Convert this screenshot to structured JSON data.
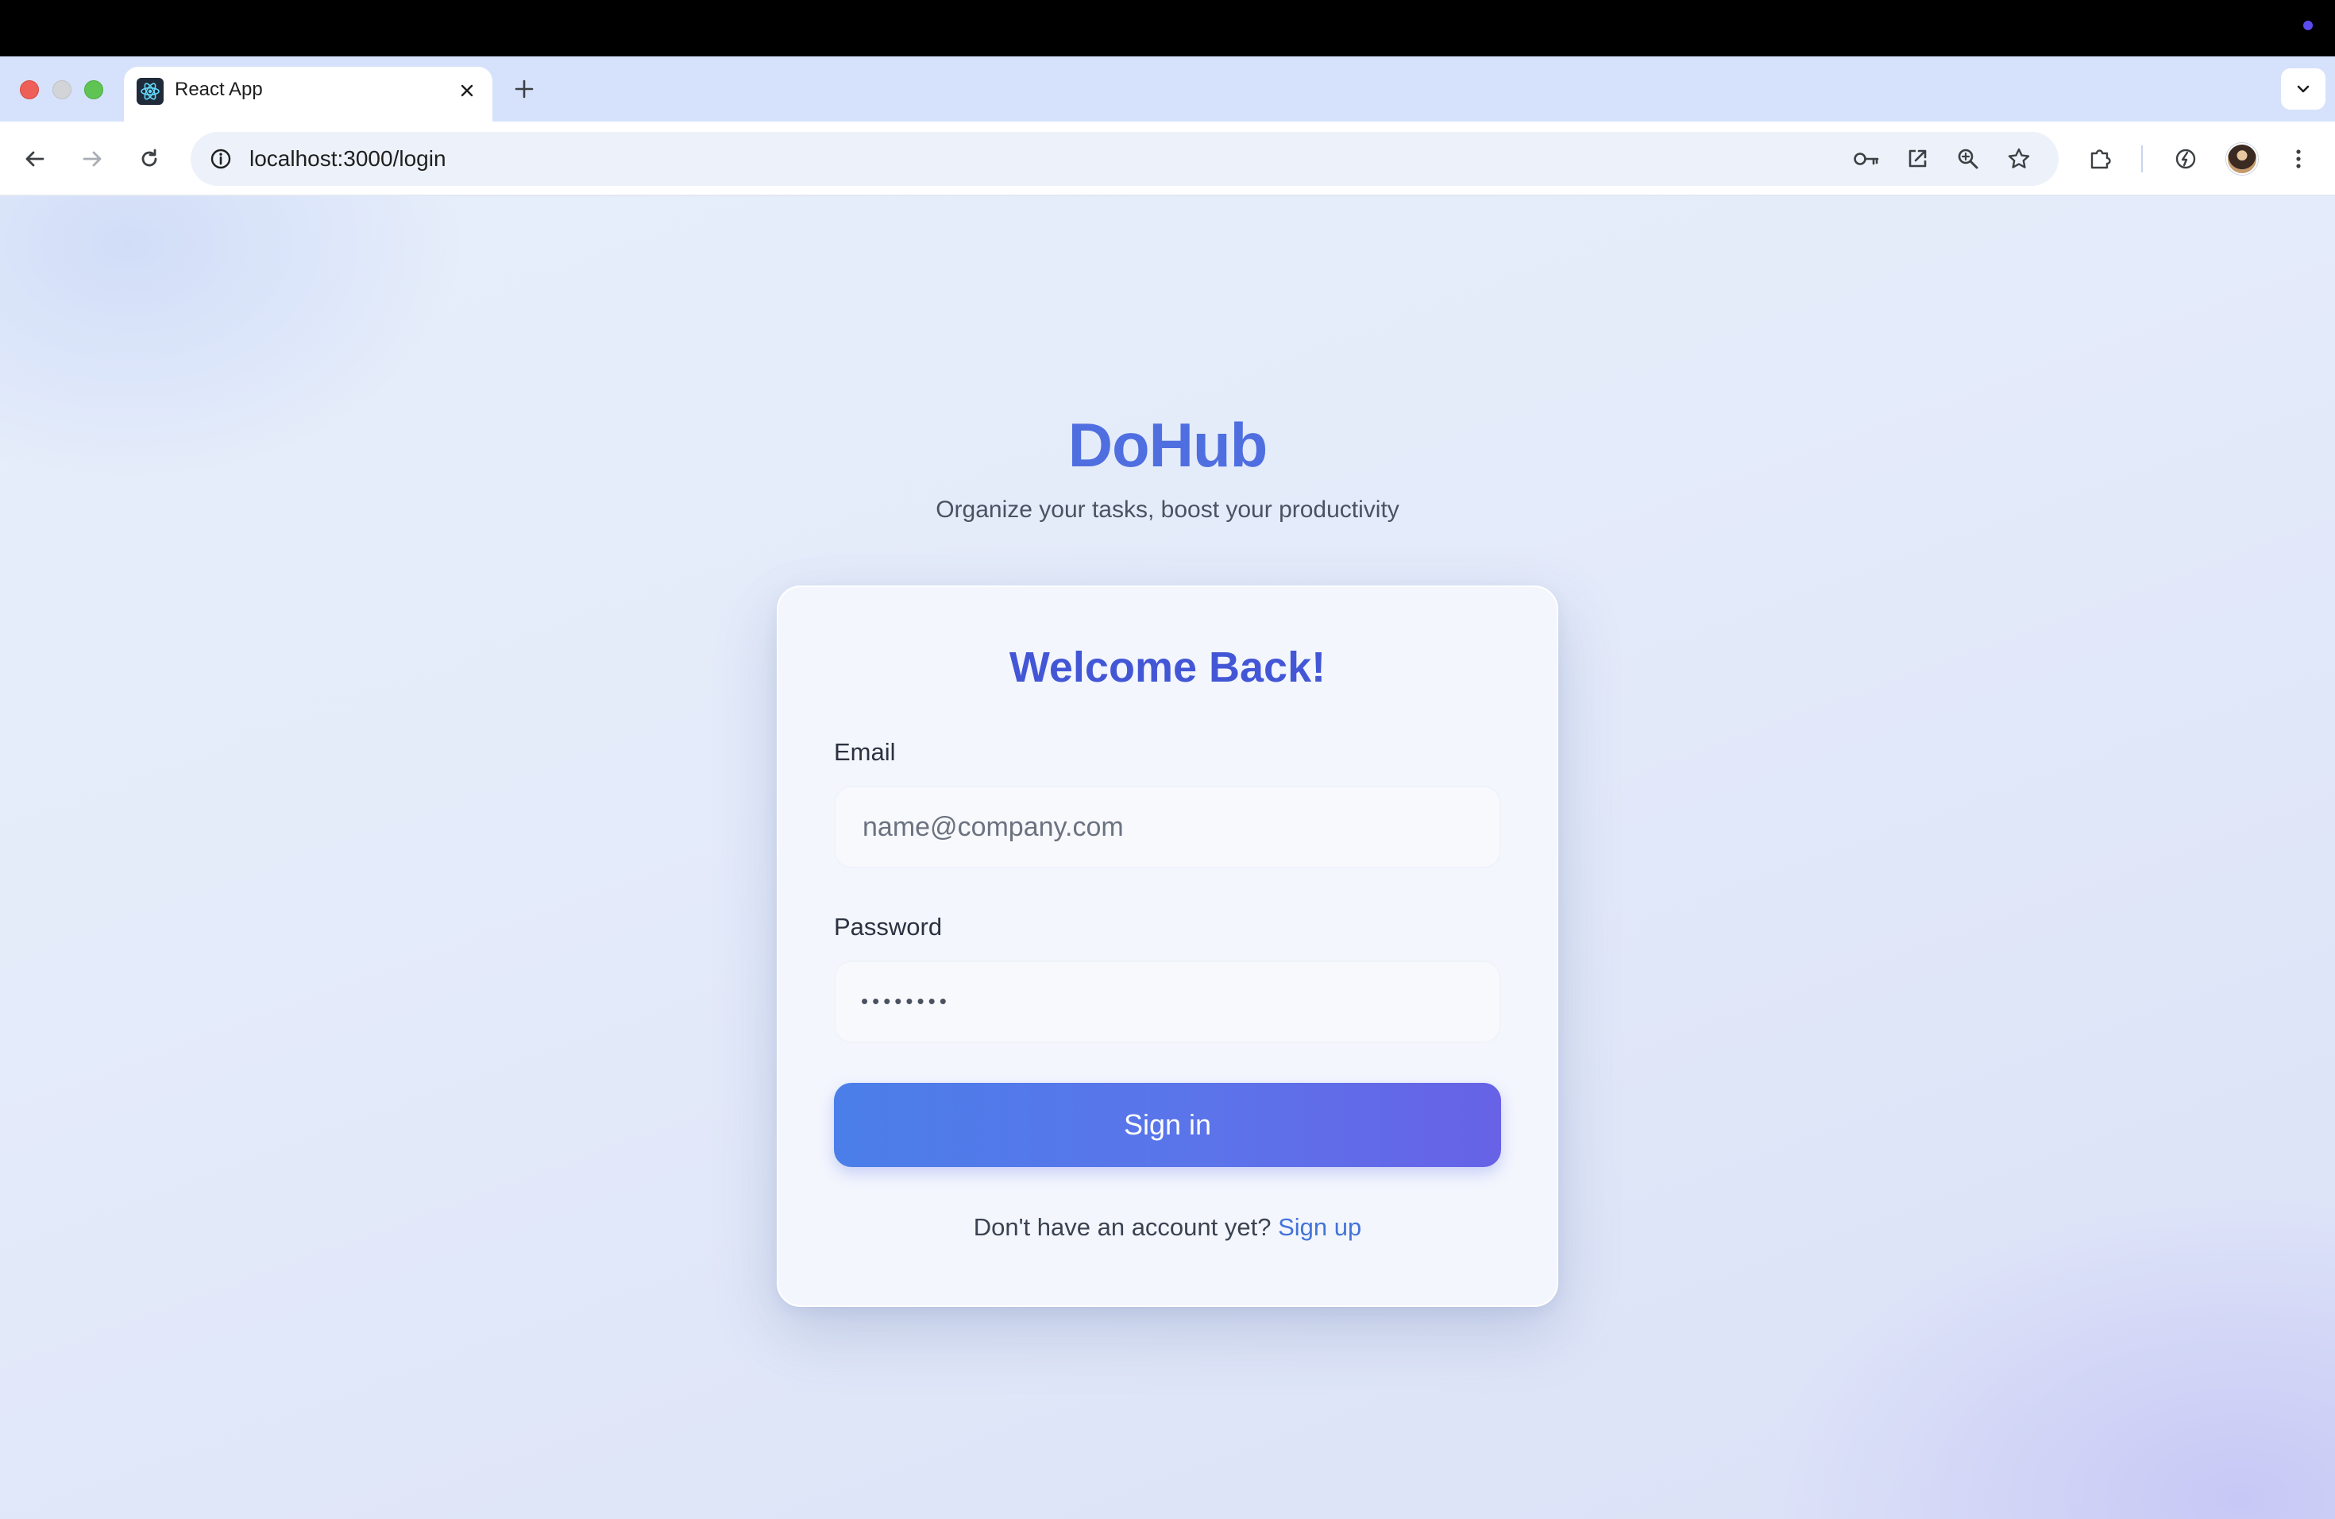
{
  "browser": {
    "tab": {
      "title": "React App",
      "favicon": "react-logo-icon"
    },
    "url": "localhost:3000/login",
    "icons": {
      "back": "arrow-left-icon",
      "forward": "arrow-right-icon",
      "reload": "reload-icon",
      "info": "info-icon",
      "password_key": "key-icon",
      "open_external": "open-external-icon",
      "zoom": "zoom-icon",
      "bookmark": "star-icon",
      "extensions": "puzzle-icon",
      "performance": "leaf-icon",
      "menu": "kebab-menu-icon"
    }
  },
  "app": {
    "brand": "DoHub",
    "tagline": "Organize your tasks, boost your productivity"
  },
  "login": {
    "title": "Welcome Back!",
    "email_label": "Email",
    "email_placeholder": "name@company.com",
    "email_value": "",
    "password_label": "Password",
    "password_masked": "••••••••",
    "submit_label": "Sign in",
    "footer_text": "Don't have an account yet?",
    "signup_link": "Sign up"
  },
  "colors": {
    "brand": "#4f6fe0",
    "title": "#4357d6",
    "button_start": "#4b7ee9",
    "button_end": "#6762e6",
    "link": "#4473d8"
  }
}
